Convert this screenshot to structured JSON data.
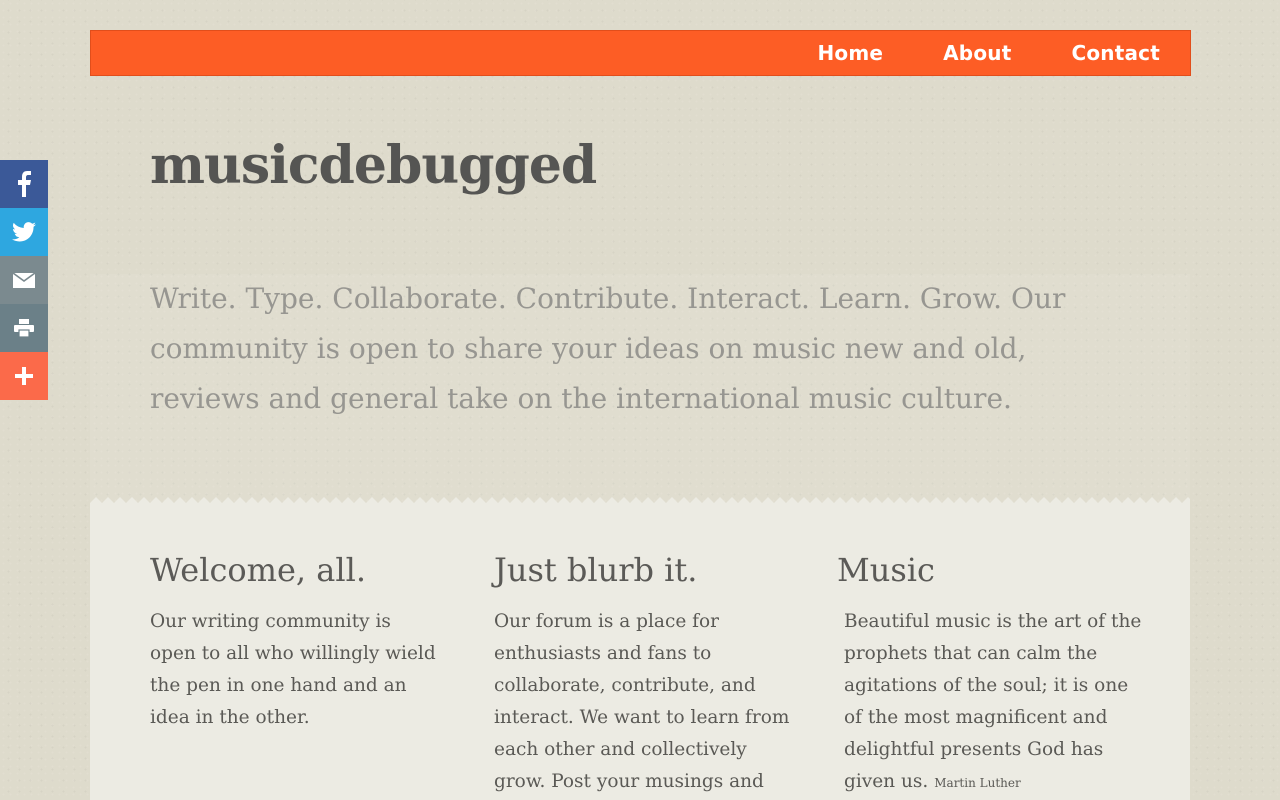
{
  "nav": {
    "items": [
      {
        "label": "Home"
      },
      {
        "label": "About"
      },
      {
        "label": "Contact"
      }
    ]
  },
  "site": {
    "title": "musicdebugged"
  },
  "share": {
    "icons": [
      "facebook-icon",
      "twitter-icon",
      "email-icon",
      "print-icon",
      "plus-icon"
    ],
    "colors": {
      "facebook": "#3b5998",
      "twitter": "#2ea7e0",
      "email": "#7b8a8f",
      "print": "#6b8088",
      "more": "#fb6a4a"
    }
  },
  "intro": {
    "text": "Write. Type. Collaborate. Contribute. Interact. Learn. Grow. Our community is open to share your ideas on music new and old, reviews and general take on the international music culture."
  },
  "columns": [
    {
      "heading": "Welcome, all.",
      "body": "Our writing community is open to all who willingly wield the pen in one hand and an idea in the other."
    },
    {
      "heading": "Just blurb it.",
      "body": "Our forum is a place for enthusiasts and fans to collaborate, contribute, and interact. We want to learn from each other and collectively grow. Post your musings and"
    },
    {
      "heading": "Music",
      "body": "Beautiful music is the art of the prophets that can calm the agitations of the soul; it is one of the most magnificent and delightful presents God has given us.",
      "attribution": "Martin Luther"
    }
  ],
  "colors": {
    "accent": "#fd5d25",
    "background": "#dedbcc",
    "panel": "#ecebe3"
  }
}
